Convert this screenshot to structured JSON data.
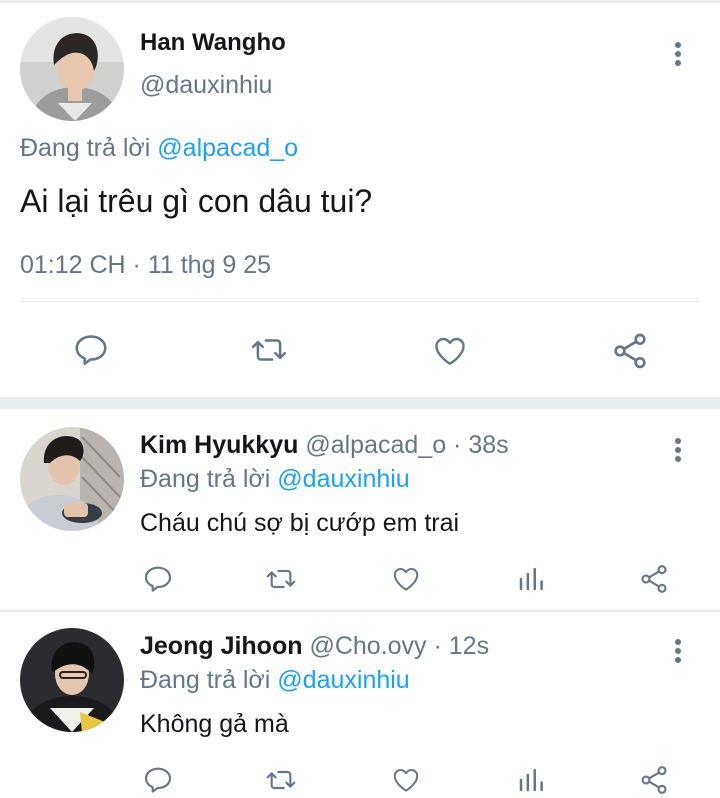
{
  "main_tweet": {
    "name": "Han Wangho",
    "handle": "@dauxinhiu",
    "replying_prefix": "Đang trả lời",
    "replying_to": "@alpacad_o",
    "text": "Ai lại trêu gì con dâu tui?",
    "timestamp": "01:12 CH · 11 thg 9 25",
    "actions": [
      "reply-icon",
      "retweet-icon",
      "like-icon",
      "share-icon"
    ]
  },
  "replies": [
    {
      "name": "Kim Hyukkyu",
      "meta": "@alpacad_o · 38s",
      "replying_prefix": "Đang trả lời",
      "replying_to": "@dauxinhiu",
      "text": "Cháu chú sợ bị cướp em trai",
      "actions": [
        "reply-icon",
        "retweet-icon",
        "like-icon",
        "analytics-icon",
        "share-icon"
      ]
    },
    {
      "name": "Jeong Jihoon",
      "meta": "@Cho.ovy · 12s",
      "replying_prefix": "Đang trả lời",
      "replying_to": "@dauxinhiu",
      "text": "Không gả mà",
      "actions": [
        "reply-icon",
        "retweet-icon",
        "like-icon",
        "analytics-icon",
        "share-icon"
      ]
    }
  ],
  "colors": {
    "accent": "#1da1f2",
    "secondary_text": "#657786",
    "primary_text": "#14171a",
    "icon": "#657786",
    "separator": "#e6ecf0"
  }
}
